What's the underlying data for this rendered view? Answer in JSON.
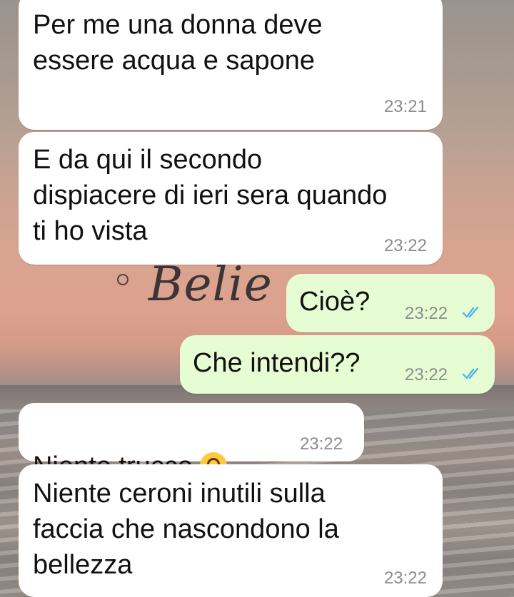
{
  "background": {
    "watermark_text": "Belie"
  },
  "messages": [
    {
      "direction": "incoming",
      "text": "Per me una donna deve\nessere acqua e sapone",
      "time": "23:21"
    },
    {
      "direction": "incoming",
      "text": "E da qui il secondo\ndispiacere di ieri sera quando\nti ho vista",
      "time": "23:22"
    },
    {
      "direction": "outgoing",
      "text": "Cioè?",
      "time": "23:22",
      "status": "read"
    },
    {
      "direction": "outgoing",
      "text": "Che intendi??",
      "time": "23:22",
      "status": "read"
    },
    {
      "direction": "incoming",
      "text": "Niente trucco",
      "emoji": "upside-down-face",
      "time": "23:22"
    },
    {
      "direction": "incoming",
      "text": "Niente ceroni inutili sulla\nfaccia che nascondono la\nbellezza",
      "time": "23:22"
    }
  ],
  "colors": {
    "incoming_bubble": "#ffffff",
    "outgoing_bubble": "#e6fdd3",
    "read_ticks": "#4fb6ec",
    "timestamp": "#8c8c8c"
  }
}
